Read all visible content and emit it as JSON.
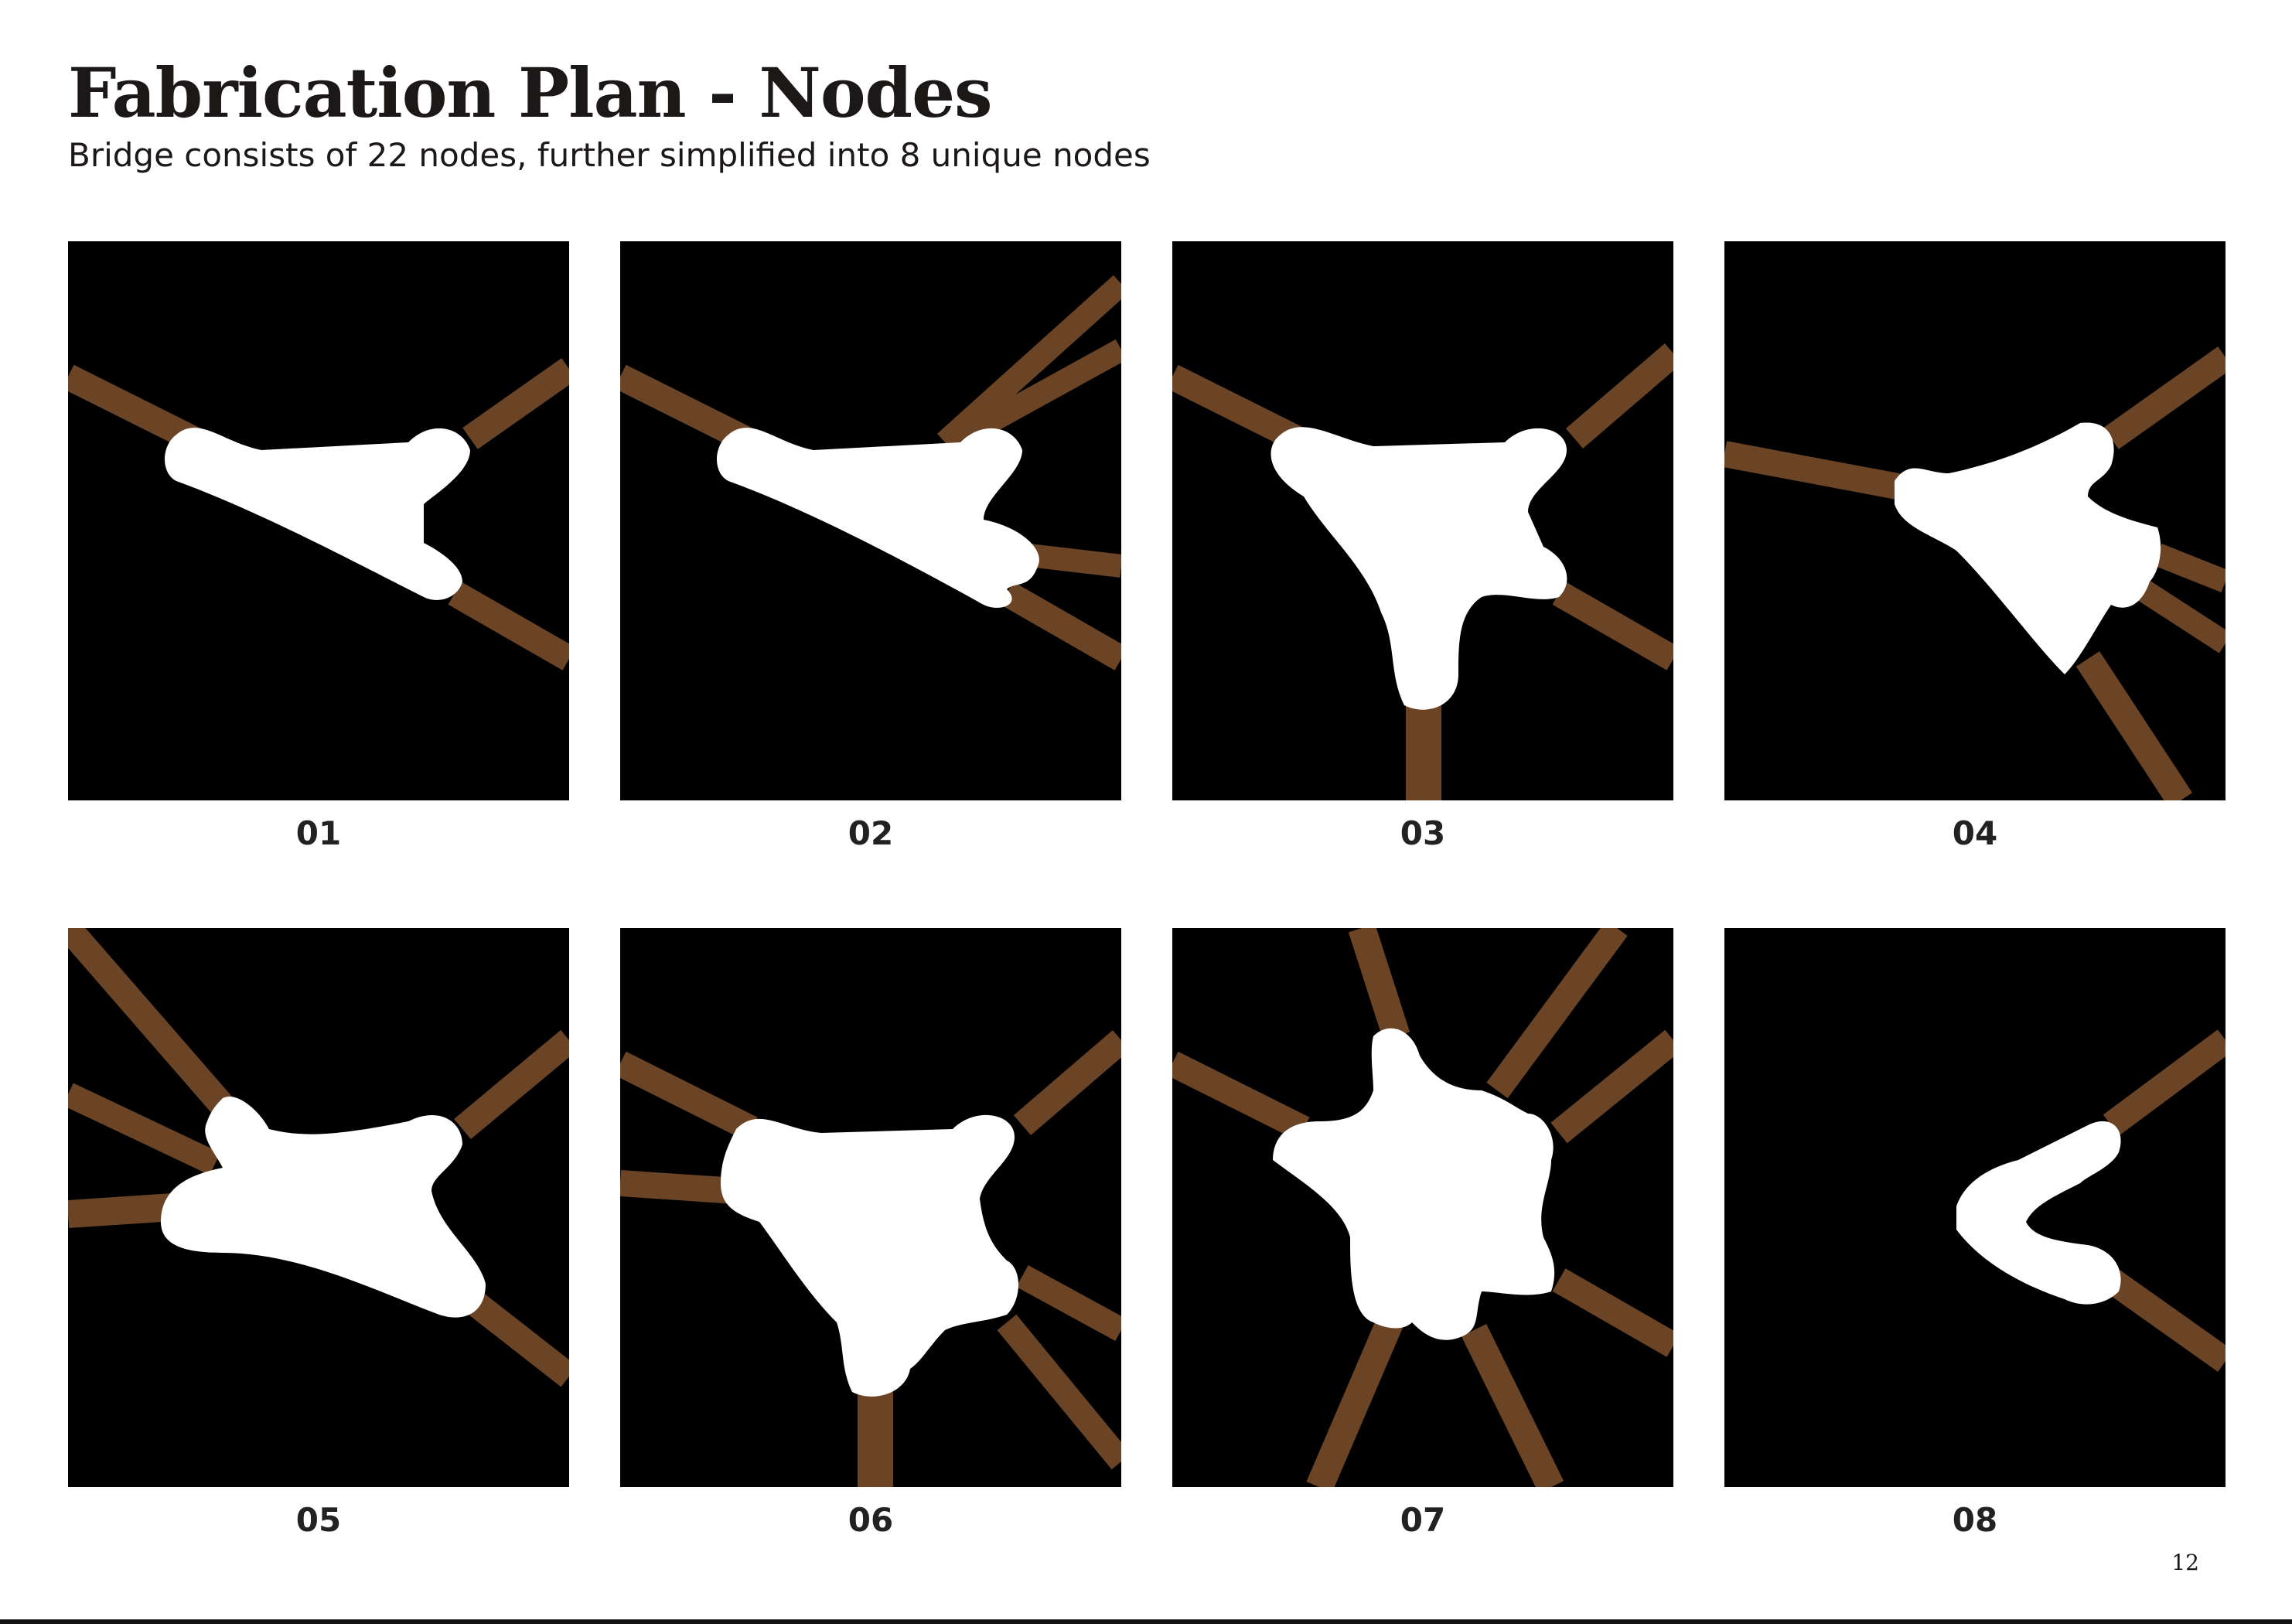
{
  "page": {
    "title": "Fabrication Plan - Nodes",
    "subtitle": "Bridge consists of 22 nodes, further simplified into 8 unique nodes",
    "page_number": "12"
  },
  "colors": {
    "background": "#000000",
    "strut": "#6b4426",
    "strut_highlight": "#8a5a34",
    "node": "#ffffff"
  },
  "nodes": [
    {
      "label": "01"
    },
    {
      "label": "02"
    },
    {
      "label": "03"
    },
    {
      "label": "04"
    },
    {
      "label": "05"
    },
    {
      "label": "06"
    },
    {
      "label": "07"
    },
    {
      "label": "08"
    }
  ]
}
